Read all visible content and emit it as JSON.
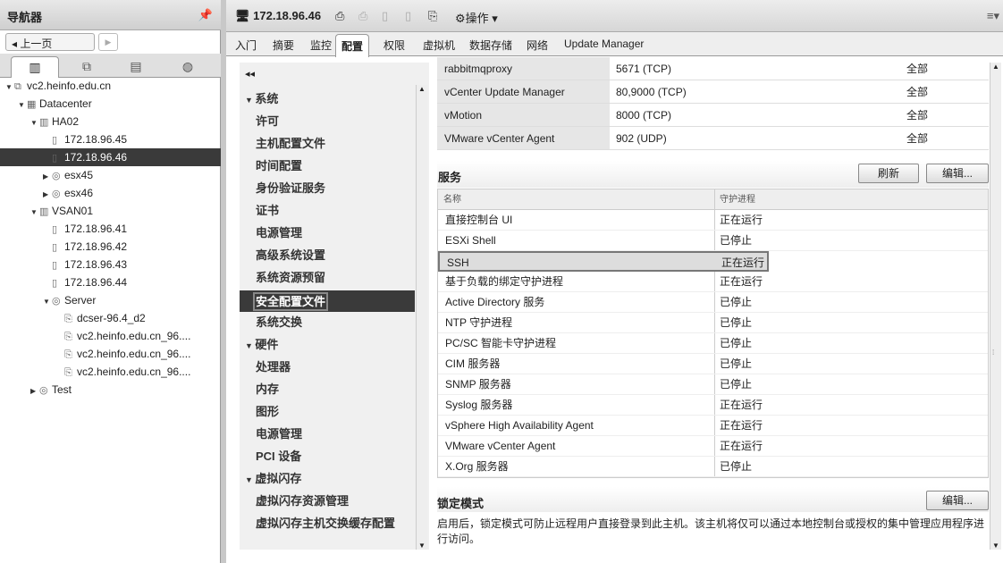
{
  "navigator": {
    "title": "导航器",
    "back": "上一页",
    "tree": [
      {
        "label": "vc2.heinfo.edu.cn",
        "level": 0,
        "arrow": "▼",
        "icon": "vcenter-icon"
      },
      {
        "label": "Datacenter",
        "level": 1,
        "arrow": "▼",
        "icon": "datacenter-icon"
      },
      {
        "label": "HA02",
        "level": 2,
        "arrow": "▼",
        "icon": "cluster-icon"
      },
      {
        "label": "172.18.96.45",
        "level": 3,
        "arrow": "",
        "icon": "host-icon"
      },
      {
        "label": "172.18.96.46",
        "level": 3,
        "arrow": "",
        "icon": "host-icon",
        "selected": true
      },
      {
        "label": "esx45",
        "level": 3,
        "arrow": "▶",
        "icon": "vapp-icon"
      },
      {
        "label": "esx46",
        "level": 3,
        "arrow": "▶",
        "icon": "vapp-icon"
      },
      {
        "label": "VSAN01",
        "level": 2,
        "arrow": "▼",
        "icon": "cluster-icon"
      },
      {
        "label": "172.18.96.41",
        "level": 3,
        "arrow": "",
        "icon": "host-icon"
      },
      {
        "label": "172.18.96.42",
        "level": 3,
        "arrow": "",
        "icon": "host-icon"
      },
      {
        "label": "172.18.96.43",
        "level": 3,
        "arrow": "",
        "icon": "host-icon"
      },
      {
        "label": "172.18.96.44",
        "level": 3,
        "arrow": "",
        "icon": "host-icon"
      },
      {
        "label": "Server",
        "level": 3,
        "arrow": "▼",
        "icon": "vapp-icon"
      },
      {
        "label": "dcser-96.4_d2",
        "level": 4,
        "arrow": "",
        "icon": "vm-icon"
      },
      {
        "label": "vc2.heinfo.edu.cn_96....",
        "level": 4,
        "arrow": "",
        "icon": "vm-icon"
      },
      {
        "label": "vc2.heinfo.edu.cn_96....",
        "level": 4,
        "arrow": "",
        "icon": "vm-icon"
      },
      {
        "label": "vc2.heinfo.edu.cn_96....",
        "level": 4,
        "arrow": "",
        "icon": "vm-icon"
      },
      {
        "label": "Test",
        "level": 2,
        "arrow": "▶",
        "icon": "vapp-icon"
      }
    ]
  },
  "header": {
    "host": "172.18.96.46",
    "actions": "操作 ▾"
  },
  "tabs": [
    "入门",
    "摘要",
    "监控",
    "配置",
    "权限",
    "虚拟机",
    "数据存储",
    "网络",
    "Update Manager"
  ],
  "config_menu": [
    {
      "label": "系统",
      "section": true
    },
    {
      "label": "许可"
    },
    {
      "label": "主机配置文件"
    },
    {
      "label": "时间配置"
    },
    {
      "label": "身份验证服务"
    },
    {
      "label": "证书"
    },
    {
      "label": "电源管理"
    },
    {
      "label": "高级系统设置"
    },
    {
      "label": "系统资源预留"
    },
    {
      "label": "安全配置文件",
      "selected": true
    },
    {
      "label": "系统交换"
    },
    {
      "label": "硬件",
      "section": true
    },
    {
      "label": "处理器"
    },
    {
      "label": "内存"
    },
    {
      "label": "图形"
    },
    {
      "label": "电源管理"
    },
    {
      "label": "PCI 设备"
    },
    {
      "label": "虚拟闪存",
      "section": true
    },
    {
      "label": "虚拟闪存资源管理"
    },
    {
      "label": "虚拟闪存主机交换缓存配置"
    }
  ],
  "firewall_rows": [
    [
      "rabbitmqproxy",
      "5671 (TCP)",
      "全部"
    ],
    [
      "vCenter Update Manager",
      "80,9000 (TCP)",
      "全部"
    ],
    [
      "vMotion",
      "8000 (TCP)",
      "全部"
    ],
    [
      "VMware vCenter Agent",
      "902 (UDP)",
      "全部"
    ]
  ],
  "services": {
    "title": "服务",
    "refresh": "刷新",
    "edit": "编辑...",
    "col_name": "名称",
    "col_daemon": "守护进程",
    "rows": [
      [
        "直接控制台 UI",
        "正在运行"
      ],
      [
        "ESXi Shell",
        "已停止"
      ],
      [
        "SSH",
        "正在运行"
      ],
      [
        "基于负载的绑定守护进程",
        "正在运行"
      ],
      [
        "Active Directory 服务",
        "已停止"
      ],
      [
        "NTP 守护进程",
        "已停止"
      ],
      [
        "PC/SC 智能卡守护进程",
        "已停止"
      ],
      [
        "CIM 服务器",
        "已停止"
      ],
      [
        "SNMP 服务器",
        "已停止"
      ],
      [
        "Syslog 服务器",
        "正在运行"
      ],
      [
        "vSphere High Availability Agent",
        "正在运行"
      ],
      [
        "VMware vCenter Agent",
        "正在运行"
      ],
      [
        "X.Org 服务器",
        "已停止"
      ]
    ]
  },
  "lockdown": {
    "title": "锁定模式",
    "edit": "编辑...",
    "desc": "启用后，锁定模式可防止远程用户直接登录到此主机。该主机将仅可以通过本地控制台或授权的集中管理应用程序进行访问。"
  }
}
